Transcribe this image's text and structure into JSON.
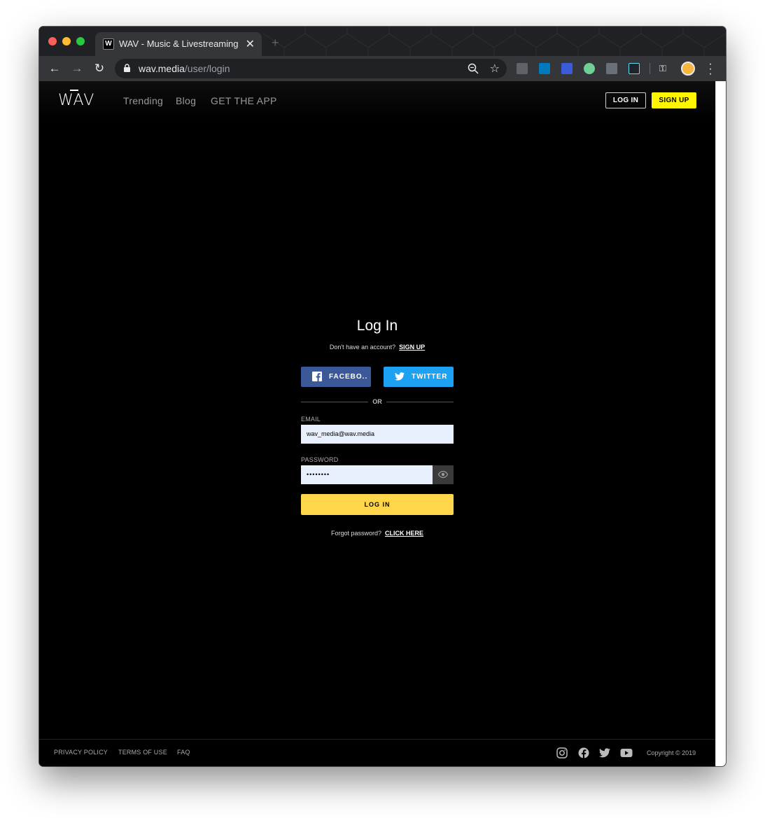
{
  "browser": {
    "tab_title": "WAV - Music & Livestreaming",
    "favicon_letter": "W",
    "url_host": "wav.media",
    "url_path": "/user/login"
  },
  "header": {
    "logo": "WAV",
    "nav": [
      "Trending",
      "Blog",
      "GET THE APP"
    ],
    "login_label": "LOG IN",
    "signup_label": "SIGN UP"
  },
  "login": {
    "title": "Log In",
    "no_account_text": "Don't have an account?",
    "signup_link": "SIGN UP",
    "facebook_label": "FACEBO..",
    "twitter_label": "TWITTER",
    "or_text": "OR",
    "email_label": "EMAIL",
    "email_value": "wav_media@wav.media",
    "password_label": "PASSWORD",
    "password_value": "••••••••",
    "submit_label": "LOG IN",
    "forgot_text": "Forgot password?",
    "forgot_link": "CLICK HERE"
  },
  "footer": {
    "links": [
      "PRIVACY POLICY",
      "TERMS OF USE",
      "FAQ"
    ],
    "social_icons": [
      "instagram-icon",
      "facebook-icon",
      "twitter-icon",
      "youtube-icon"
    ],
    "copyright": "Copyright © 2019"
  },
  "colors": {
    "accent_yellow": "#ffd54a",
    "signup_yellow": "#fff700",
    "facebook_blue": "#3b5998",
    "twitter_blue": "#1da1f2"
  }
}
